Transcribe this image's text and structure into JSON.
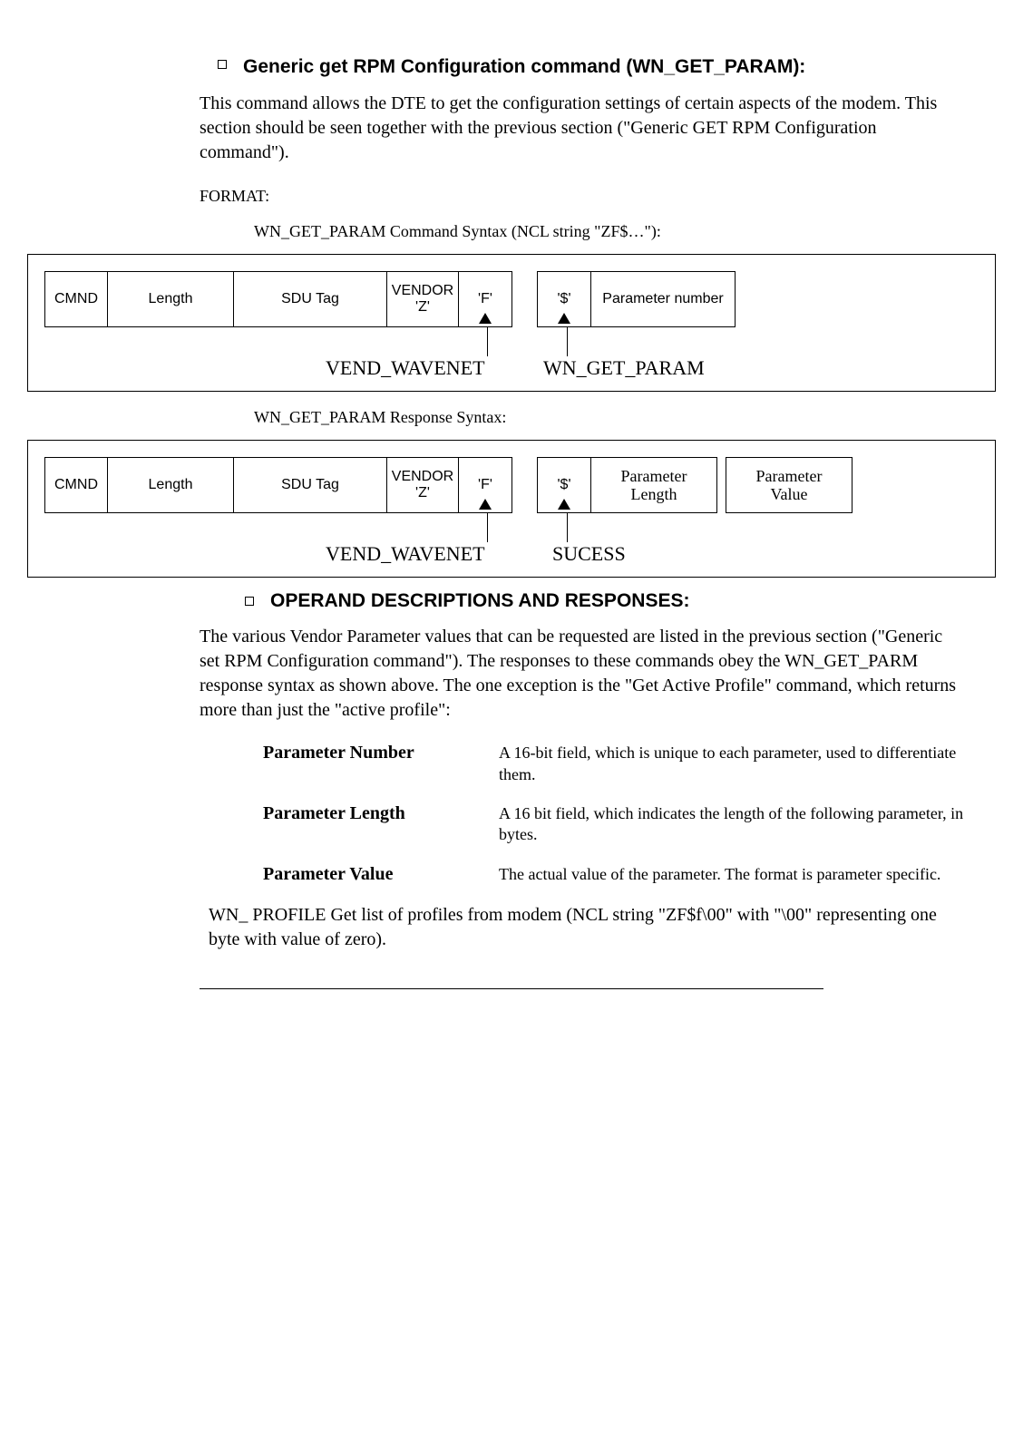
{
  "heading1": "Generic get RPM Configuration command (WN_GET_PARAM):",
  "intro_para": "This command allows the DTE to get the configuration settings of certain aspects of the modem.  This section should be seen together with the previous section (\"Generic GET RPM Configuration command\").",
  "format_label": "FORMAT:",
  "caption1": "WN_GET_PARAM Command Syntax (NCL string \"ZF$…\"):",
  "caption2": "WN_GET_PARAM Response Syntax:",
  "cells": {
    "cmnd": "CMND",
    "length": "Length",
    "sdu": "SDU Tag",
    "vendor_l1": "VENDOR",
    "vendor_l2": "'Z'",
    "f": "'F'",
    "dollar": "'$'",
    "param_num": "Parameter number",
    "param_len_l1": "Parameter",
    "param_len_l2": "Length",
    "param_val_l1": "Parameter",
    "param_val_l2": "Value"
  },
  "diagram_labels": {
    "vend_wavenet": "VEND_WAVENET",
    "wn_get_param": "WN_GET_PARAM",
    "sucess": "SUCESS"
  },
  "heading2": "OPERAND DESCRIPTIONS AND RESPONSES:",
  "operand_para": "The various Vendor Parameter values that can be requested  are listed in the previous section (\"Generic set RPM Configuration command\"). The responses to these commands obey the WN_GET_PARM response syntax as  shown above. The one exception is the \"Get Active Profile\" command, which returns more than just the \"active profile\":",
  "params": [
    {
      "name": "Parameter Number",
      "desc": "A 16-bit field, which is unique to each parameter, used to differentiate them."
    },
    {
      "name": "Parameter Length",
      "desc": "A 16 bit field, which indicates the length of the following parameter, in bytes."
    },
    {
      "name": "Parameter Value",
      "desc": "The actual value of the parameter.  The format is parameter specific."
    }
  ],
  "profile_para": "WN_ PROFILE  Get  list of profiles from modem (NCL string \"ZF$f\\00\" with \"\\00\"  representing one byte with value of zero)."
}
